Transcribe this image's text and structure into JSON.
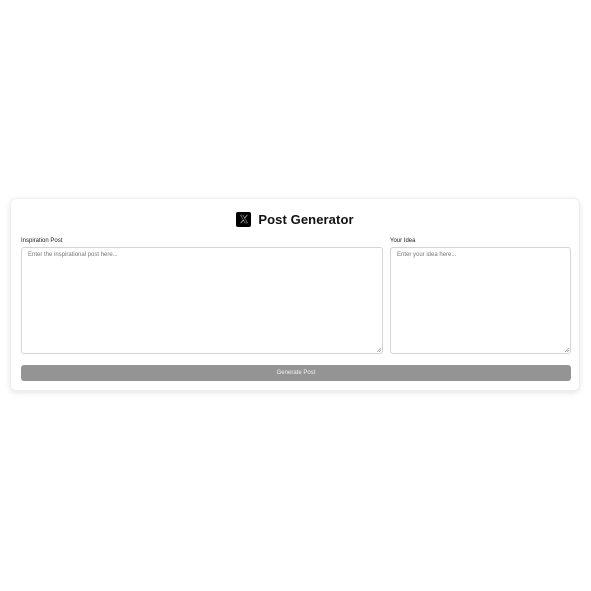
{
  "app": {
    "title": "Post Generator",
    "logo_icon": "x-logo-icon"
  },
  "form": {
    "inspiration": {
      "label": "Inspiration Post",
      "placeholder": "Enter the inspirational post here...",
      "value": ""
    },
    "idea": {
      "label": "Your Idea",
      "placeholder": "Enter your idea here...",
      "value": ""
    },
    "submit": {
      "label": "Generate Post",
      "enabled": false
    }
  },
  "colors": {
    "button_disabled_bg": "#949494",
    "logo_bg": "#000000",
    "border": "#d4d4d4"
  }
}
